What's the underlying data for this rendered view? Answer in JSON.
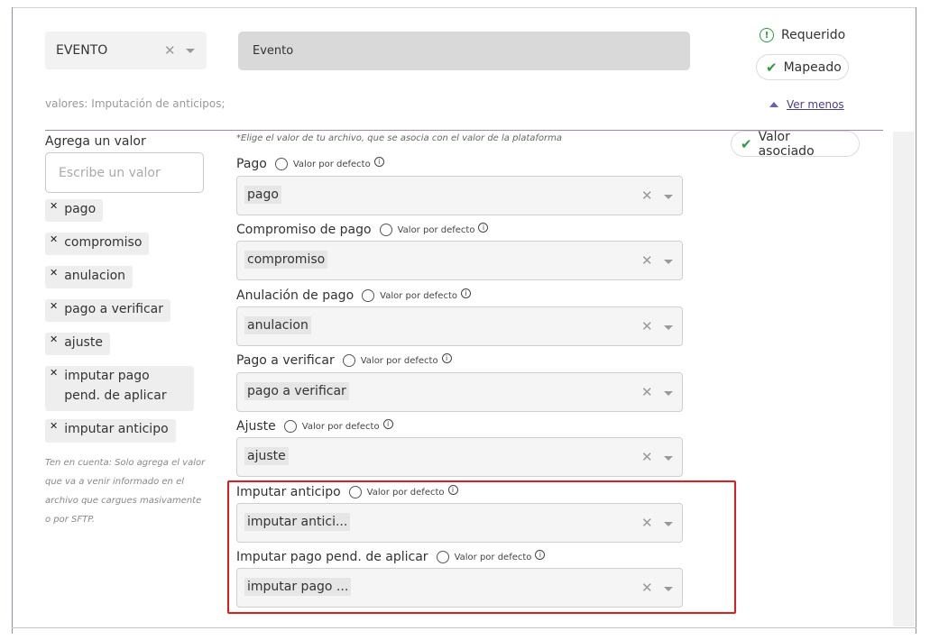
{
  "mapping": {
    "source_column": "EVENTO",
    "field_name": "Evento",
    "requerido_label": "Requerido",
    "mapeado_label": "Mapeado",
    "valores_note": "valores: Imputación de anticipos;",
    "ver_menos_label": "Ver menos",
    "valor_asociado_label": "Valor asociado"
  },
  "left_panel": {
    "title": "Agrega un valor",
    "input_placeholder": "Escribe un valor",
    "chips": [
      "pago",
      "compromiso",
      "anulacion",
      "pago a verificar",
      "ajuste",
      "imputar pago pend. de aplicar",
      "imputar anticipo"
    ],
    "note": "Ten en cuenta: Solo agrega el valor que va a venir informado en el archivo que cargues masivamente o por SFTP."
  },
  "right_panel": {
    "instruction": "*Elige el valor de tu archivo, que se asocia con el valor de la plataforma",
    "default_label": "Valor por defecto",
    "fields": [
      {
        "label": "Pago",
        "value": "pago"
      },
      {
        "label": "Compromiso de pago",
        "value": "compromiso"
      },
      {
        "label": "Anulación de pago",
        "value": "anulacion"
      },
      {
        "label": "Pago a verificar",
        "value": "pago a verificar"
      },
      {
        "label": "Ajuste",
        "value": "ajuste"
      },
      {
        "label": "Imputar anticipo",
        "value": "imputar antici..."
      },
      {
        "label": "Imputar pago pend. de aplicar",
        "value": "imputar pago ..."
      }
    ]
  },
  "colors": {
    "highlight": "#e21b1b",
    "success": "#2e9b3e",
    "link": "#4a3f8c"
  }
}
